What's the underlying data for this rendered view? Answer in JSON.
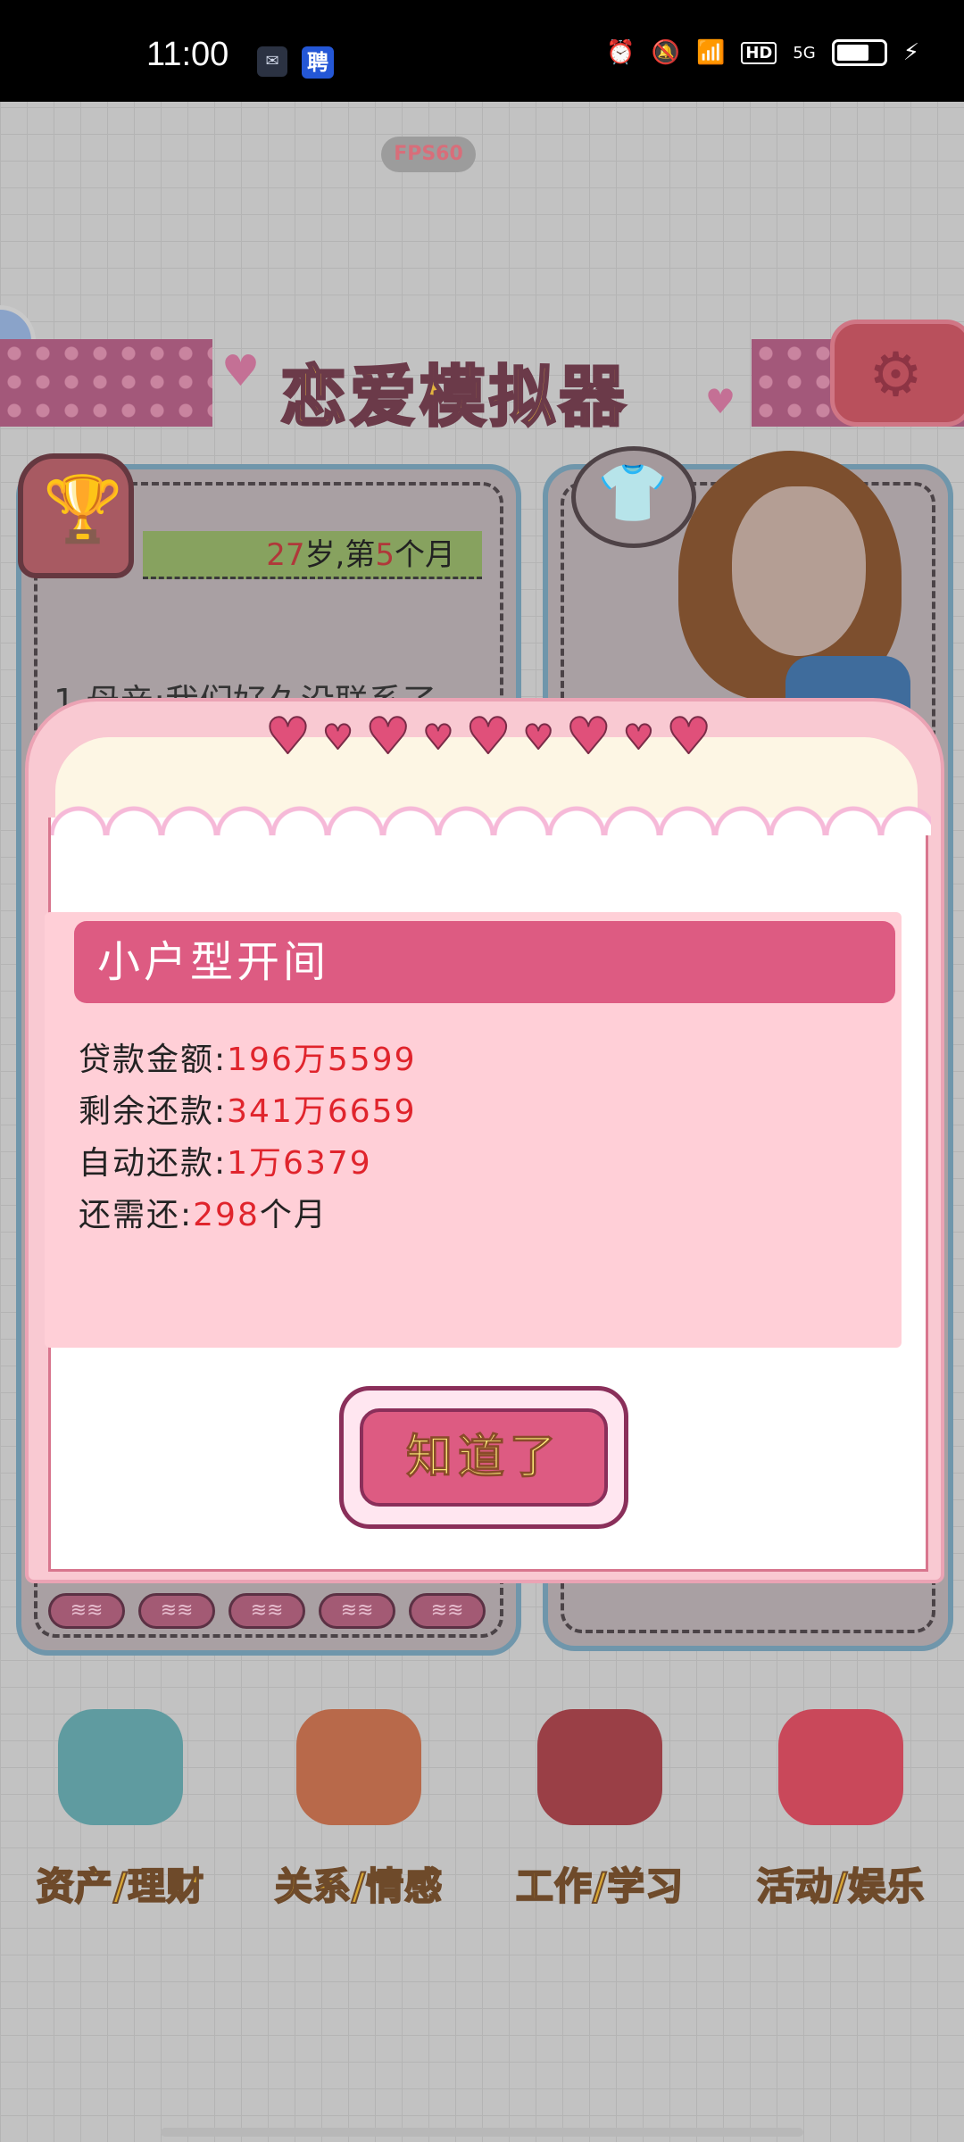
{
  "status_bar": {
    "time": "11:00",
    "app_icon_2": "聘",
    "hd_label": "HD",
    "network_label": "5G",
    "battery_level": 0.7
  },
  "fps_label": "FPS60",
  "game": {
    "title": "恋爱模拟器",
    "age_prefix": "27",
    "age_suffix": "岁,第",
    "month_num": "5",
    "month_suffix": "个月",
    "news_line": "1.母亲:我们好久没联系了"
  },
  "dialog": {
    "title": "小户型开间",
    "rows": [
      {
        "label": "贷款金额:",
        "value": "196万5599",
        "suffix": ""
      },
      {
        "label": "剩余还款:",
        "value": "341万6659",
        "suffix": ""
      },
      {
        "label": "自动还款:",
        "value": "1万6379",
        "suffix": ""
      },
      {
        "label": "还需还:",
        "value": "298",
        "suffix": "个月"
      }
    ],
    "ok_label": "知道了"
  },
  "menu": {
    "items": [
      {
        "label": "资产/理财",
        "icon": "piggy-bank-icon"
      },
      {
        "label": "关系/情感",
        "icon": "coffee-cups-icon"
      },
      {
        "label": "工作/学习",
        "icon": "open-book-icon"
      },
      {
        "label": "活动/娱乐",
        "icon": "popcorn-icon"
      }
    ]
  },
  "colors": {
    "dialog_pink": "#f9c9d2",
    "title_bar": "#dd5b82",
    "value_red": "#e0242c",
    "menu_gold": "#d8a733"
  }
}
